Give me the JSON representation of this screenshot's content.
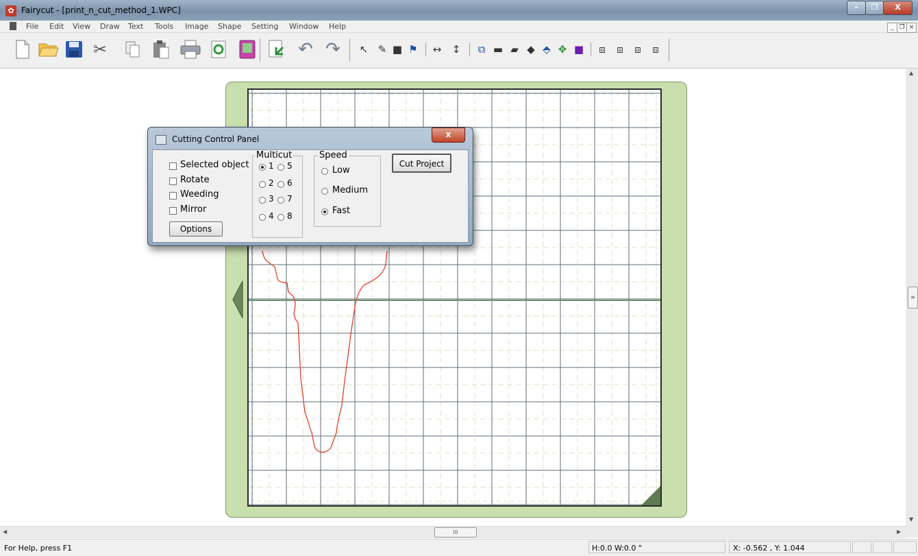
{
  "window": {
    "title": "Fairycut - [print_n_cut_method_1.WPC]"
  },
  "menu": [
    "File",
    "Edit",
    "View",
    "Draw",
    "Text",
    "Tools",
    "Image",
    "Shape",
    "Setting",
    "Window",
    "Help"
  ],
  "toolbar": {
    "main": [
      "new",
      "open",
      "save",
      "cut",
      "copy",
      "paste",
      "print",
      "refresh",
      "library",
      "import",
      "undo",
      "redo"
    ],
    "tools": [
      "select",
      "node-edit",
      "fill",
      "flag",
      "flip-horizontal",
      "flip-vertical",
      "group",
      "rectangle",
      "parallelogram",
      "diamond",
      "pen-shape",
      "move",
      "solid-fill",
      "weld",
      "intersect",
      "trim",
      "break-apart"
    ]
  },
  "dialog": {
    "title": "Cutting Control Panel",
    "close": "x",
    "checkboxes": [
      {
        "label": "Selected object",
        "checked": false
      },
      {
        "label": "Rotate",
        "checked": false
      },
      {
        "label": "Weeding",
        "checked": false
      },
      {
        "label": "Mirror",
        "checked": false
      }
    ],
    "options_button": "Options",
    "multicut": {
      "title": "Multicut",
      "options": [
        "1",
        "2",
        "3",
        "4",
        "5",
        "6",
        "7",
        "8"
      ],
      "selected": "1"
    },
    "speed": {
      "title": "Speed",
      "options": [
        "Low",
        "Medium",
        "Fast"
      ],
      "selected": "Fast"
    },
    "cut_button": "Cut Project"
  },
  "status": {
    "help": "For Help, press F1",
    "size": "H:0.0  W:0.0 \"",
    "coords": "X: -0.562 , Y: 1.044"
  },
  "scroll": {
    "thumb_label": "III"
  },
  "colors": {
    "mat": "#c9dfae",
    "cut_path": "#e0402a",
    "major_grid": "#5c6e78",
    "minor_grid": "#d6dfbb"
  }
}
